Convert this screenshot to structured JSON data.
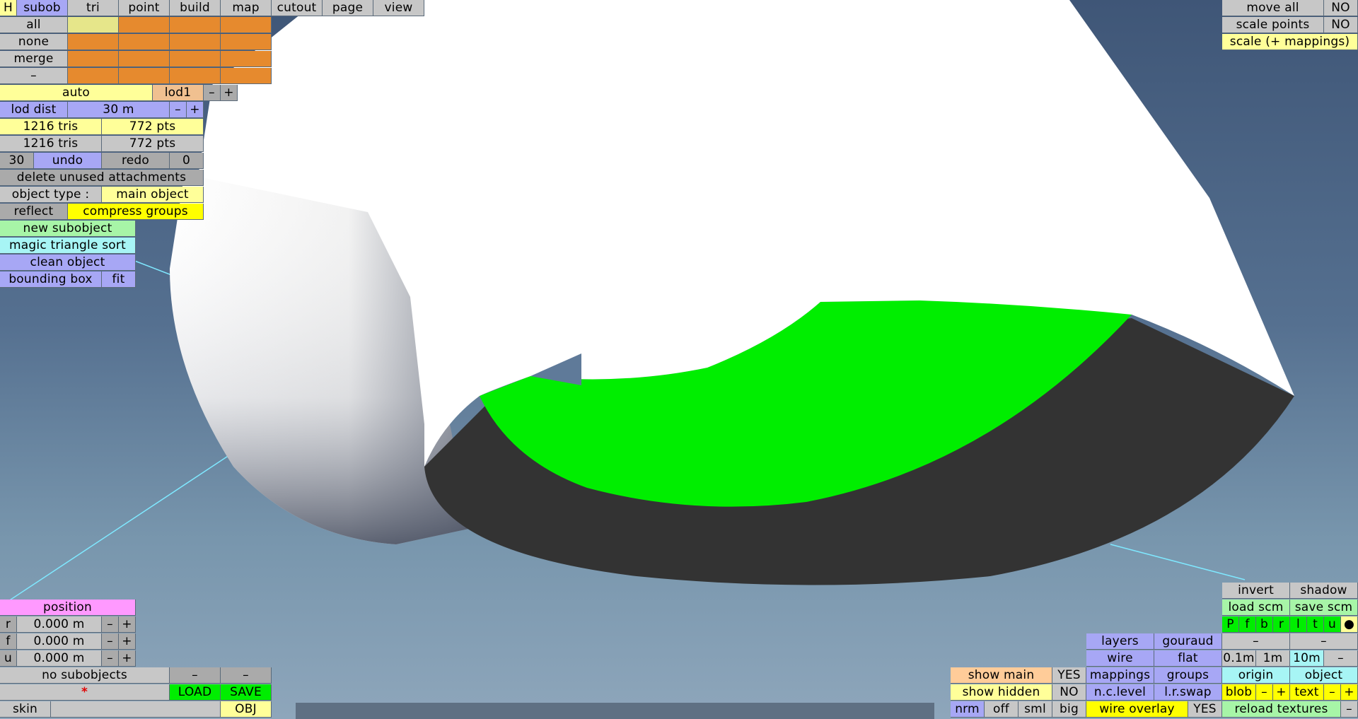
{
  "top_menu": {
    "h": "H",
    "subob": "subob",
    "tri": "tri",
    "point": "point",
    "build": "build",
    "map": "map",
    "cutout": "cutout",
    "page": "page",
    "view": "view"
  },
  "selection": {
    "all": "all",
    "none": "none",
    "merge": "merge",
    "minus": "–"
  },
  "lod": {
    "auto": "auto",
    "level": "lod1",
    "minus": "–",
    "plus": "+",
    "dist_label": "lod dist",
    "dist_value": "30 m",
    "dist_minus": "–",
    "dist_plus": "+"
  },
  "stats": {
    "tris1": "1216 tris",
    "pts1": "772 pts",
    "tris2": "1216 tris",
    "pts2": "772 pts"
  },
  "history": {
    "undo_count": "30",
    "undo": "undo",
    "redo": "redo",
    "redo_count": "0"
  },
  "actions": {
    "delete_unused": "delete unused attachments",
    "object_type_label": "object type :",
    "object_type_value": "main object",
    "reflect": "reflect",
    "compress_groups": "compress groups",
    "new_subobject": "new subobject",
    "magic_sort": "magic triangle sort",
    "clean_object": "clean object",
    "bounding_box": "bounding box",
    "fit": "fit"
  },
  "top_right": {
    "move_all": "move all",
    "move_all_value": "NO",
    "scale_points": "scale points",
    "scale_points_value": "NO",
    "scale_mappings": "scale (+ mappings)"
  },
  "position": {
    "title": "position",
    "r_label": "r",
    "r_value": "0.000 m",
    "f_label": "f",
    "f_value": "0.000 m",
    "u_label": "u",
    "u_value": "0.000 m",
    "minus": "–",
    "plus": "+"
  },
  "subobjects": {
    "label": "no subobjects",
    "minus": "–",
    "asterisk": "*",
    "load": "LOAD",
    "save": "SAVE",
    "skin": "skin",
    "obj": "OBJ"
  },
  "right_panel": {
    "invert": "invert",
    "shadow": "shadow",
    "load_scm": "load scm",
    "save_scm": "save scm",
    "views": [
      "P",
      "f",
      "b",
      "r",
      "l",
      "t",
      "u",
      "●"
    ],
    "layers": "layers",
    "gouraud": "gouraud",
    "dash": "–",
    "wire": "wire",
    "flat": "flat",
    "s01": "0.1m",
    "s1": "1m",
    "s10": "10m",
    "show_main": "show main",
    "show_main_value": "YES",
    "mappings": "mappings",
    "groups": "groups",
    "origin": "origin",
    "object": "object",
    "show_hidden": "show hidden",
    "show_hidden_value": "NO",
    "nc_level": "n.c.level",
    "lr_swap": "l.r.swap",
    "blob": "blob",
    "text": "text",
    "minus": "–",
    "plus": "+",
    "nrm": "nrm",
    "off": "off",
    "sml": "sml",
    "big": "big",
    "wire_overlay": "wire overlay",
    "wire_overlay_value": "YES",
    "reload_textures": "reload textures"
  },
  "colors": {
    "background_top": "#3f5677",
    "background_bottom": "#8ea6bb",
    "model_white": "#ffffff",
    "model_green": "#00ee00",
    "model_dark": "#333333",
    "guide_lines": "#7fe8ff"
  }
}
